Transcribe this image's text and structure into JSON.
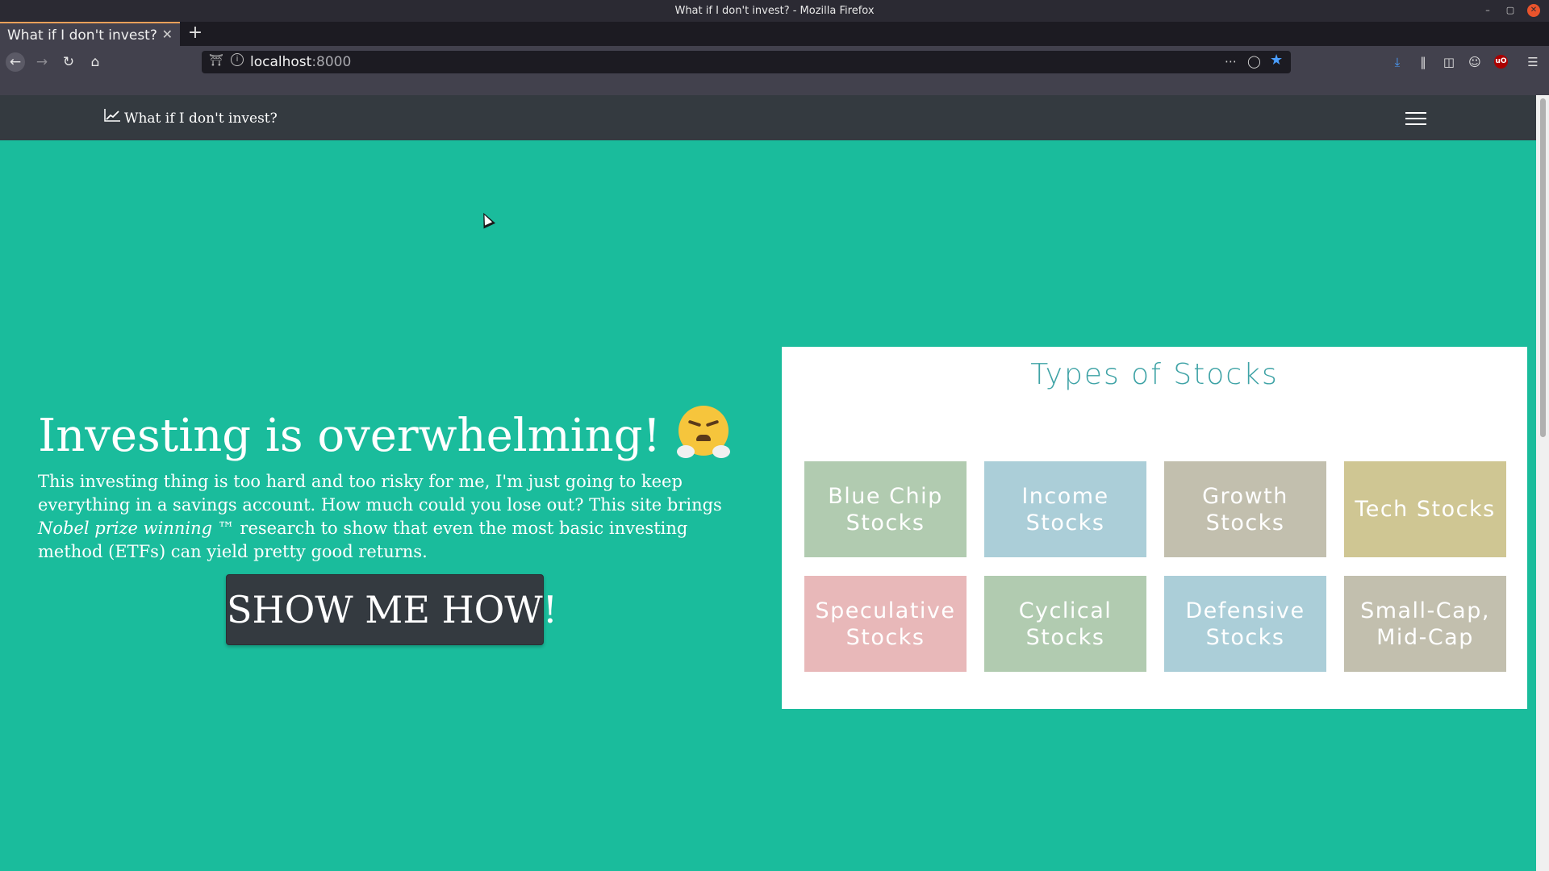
{
  "window": {
    "title": "What if I don't invest? - Mozilla Firefox"
  },
  "browser": {
    "tab_title": "What if I don't invest?",
    "url_host": "localhost",
    "url_port": ":8000"
  },
  "site": {
    "brand": "What if I don't invest?",
    "hero": {
      "title": "Investing is overwhelming!",
      "text_before": "This investing thing is too hard and too risky for me, I'm just going to keep everything in a savings account. How much could you lose out? This site brings ",
      "text_emphasis": "Nobel prize winning ™",
      "text_after": " research to show that even the most basic investing method (ETFs) can yield pretty good returns.",
      "cta_label": "SHOW ME HOW!"
    },
    "stocks_card": {
      "title": "Types of Stocks",
      "tiles": [
        {
          "label": "Blue Chip Stocks",
          "color": "#b1cbb0"
        },
        {
          "label": "Income Stocks",
          "color": "#abced8"
        },
        {
          "label": "Growth Stocks",
          "color": "#c2bfae"
        },
        {
          "label": "Tech Stocks",
          "color": "#cfc693"
        },
        {
          "label": "Speculative Stocks",
          "color": "#e8b8b9"
        },
        {
          "label": "Cyclical Stocks",
          "color": "#b1cbb0"
        },
        {
          "label": "Defensive Stocks",
          "color": "#abced8"
        },
        {
          "label": "Small-Cap, Mid-Cap",
          "color": "#c2bfae"
        }
      ]
    }
  },
  "colors": {
    "page_background": "#1abc9c",
    "navbar": "#343a40",
    "card_title": "#3fa3a6",
    "accent_blue": "#4a9eff"
  },
  "icons": {
    "brand": "chart-increasing-icon",
    "hero_emoji": "face-with-steam-from-nose-icon",
    "menu": "hamburger-menu-icon"
  }
}
